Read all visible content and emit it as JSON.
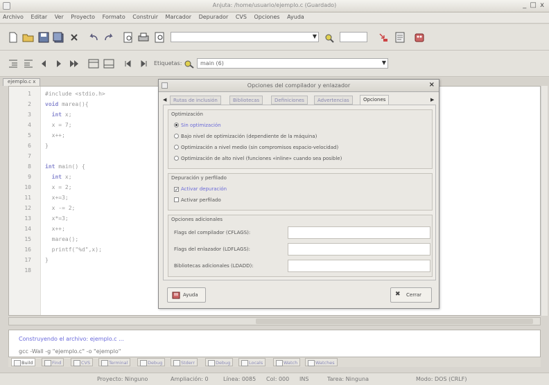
{
  "window": {
    "title": "Anjuta: /home/usuario/ejemplo.c (Guardado)",
    "controls": "_ □ x"
  },
  "menu": [
    "Archivo",
    "Editar",
    "Ver",
    "Proyecto",
    "Formato",
    "Construir",
    "Marcador",
    "Depurador",
    "CVS",
    "Opciones",
    "Ayuda"
  ],
  "toolbar2": {
    "labels_caption": "Etiquetas:",
    "function_value": "main (6)"
  },
  "doc_tab": "ejemplo.c x",
  "code": {
    "line_numbers": [
      "1",
      "2",
      "3",
      "4",
      "5",
      "6",
      "7",
      "8",
      "9",
      "10",
      "11",
      "12",
      "13",
      "14",
      "15",
      "16",
      "17",
      "18"
    ],
    "lines": [
      "#include <stdio.h>",
      "void marea(){",
      "  int x;",
      "  x = 7;",
      "  x++;",
      "}",
      "",
      "int main() {",
      "  int x;",
      "  x = 2;",
      "  x+=3;",
      "  x -= 2;",
      "  x*=3;",
      "  x++;",
      "  marea();",
      "  printf(\"%d\",x);",
      "}",
      ""
    ]
  },
  "dialog": {
    "title": "Opciones del compilador y enlazador",
    "tabs": [
      "Rutas de inclusión",
      "Bibliotecas",
      "Definiciones",
      "Advertencias",
      "Opciones"
    ],
    "active_tab": "Opciones",
    "optimization": {
      "title": "Optimización",
      "options": [
        "Sin optimización",
        "Bajo nivel de optimización (dependiente de la máquina)",
        "Optimización a nivel medio (sin compromisos espacio-velocidad)",
        "Optimización de alto nivel (funciones «inline» cuando sea posible)"
      ],
      "selected_index": 0
    },
    "debug": {
      "title": "Depuración y perfilado",
      "options": [
        "Activar depuración",
        "Activar perfilado"
      ],
      "checked": [
        true,
        false
      ]
    },
    "additional": {
      "title": "Opciones adicionales",
      "fields": [
        {
          "label": "Flags del compilador (CFLAGS):",
          "value": ""
        },
        {
          "label": "Flags del enlazador (LDFLAGS):",
          "value": ""
        },
        {
          "label": "Bibliotecas adicionales (LDADD):",
          "value": ""
        }
      ]
    },
    "help_button": "Ayuda",
    "close_button": "Cerrar"
  },
  "messages": {
    "line1": "Construyendo el archivo: ejemplo.c ...",
    "line2": "gcc  -Wall  -g  \"ejemplo.c\"  -o \"ejemplo\"",
    "tabs": [
      "Build",
      "Find",
      "CVS",
      "Terminal",
      "Debug",
      "Stderr",
      "Debug",
      "Locals",
      "Watch",
      "Watches"
    ]
  },
  "status": {
    "project": "Proyecto: Ninguno",
    "zoom": "Ampliación: 0",
    "line": "Línea: 0085",
    "col": "Col: 000",
    "ins": "INS",
    "mode_tag": "Tarea: Ninguna",
    "eol": "Modo: DOS (CRLF)"
  },
  "colors": {
    "accent": "#6a6adb",
    "keyword": "#8a8ad0"
  }
}
